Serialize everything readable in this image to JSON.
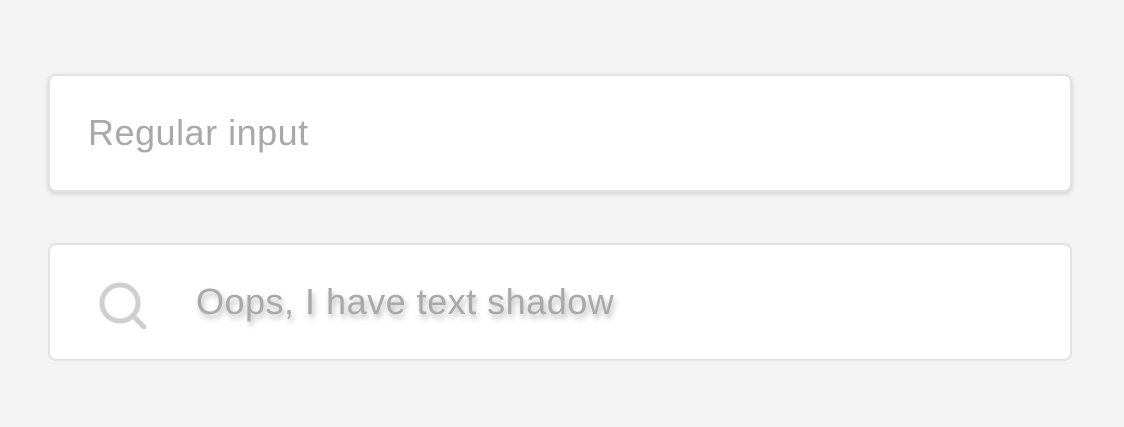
{
  "inputs": {
    "regular": {
      "placeholder": "Regular input"
    },
    "search": {
      "placeholder": "Oops, I have text shadow",
      "icon": "search-icon"
    }
  },
  "colors": {
    "background": "#f3f3f3",
    "field_background": "#ffffff",
    "border": "#e2e2e2",
    "placeholder": "#a9a9a9",
    "icon": "#cfcfcf"
  }
}
